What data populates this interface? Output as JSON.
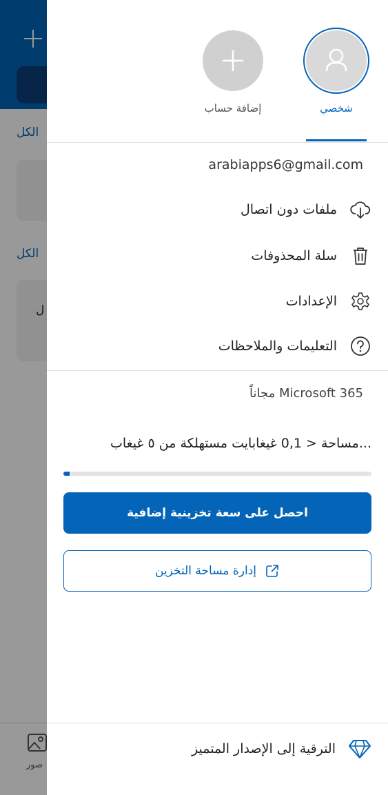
{
  "background": {
    "link_all_1": "الكل",
    "link_all_2": "الكل",
    "card_fragment": "ل",
    "photos_label": "صور"
  },
  "accounts": {
    "personal_label": "شخصي",
    "add_label": "إضافة حساب"
  },
  "email": "arabiapps6@gmail.com",
  "menu": [
    {
      "label": "ملفات دون اتصال",
      "icon": "cloud-download-icon"
    },
    {
      "label": "سلة المحذوفات",
      "icon": "trash-icon"
    },
    {
      "label": "الإعدادات",
      "icon": "gear-icon"
    },
    {
      "label": "التعليمات والملاحظات",
      "icon": "help-icon"
    }
  ],
  "plan": {
    "name": "Microsoft 365",
    "suffix": "مجاناً"
  },
  "storage": {
    "text": "مساحة < 0,1 غيغابايت مستهلكة من ٥ غيغاب...",
    "used_fraction": 0.02
  },
  "buttons": {
    "get_more_storage": "احصل على سعة تخزينية إضافية",
    "manage_storage": "إدارة مساحة التخزين"
  },
  "upgrade_label": "الترقية إلى الإصدار المتميز",
  "colors": {
    "accent": "#0364b8"
  }
}
